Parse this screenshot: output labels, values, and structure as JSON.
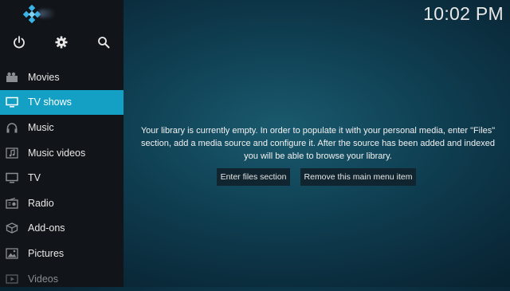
{
  "clock": "10:02 PM",
  "sidebar": {
    "logo_icon": "kodi-logo-icon",
    "top_icons": [
      "power-icon",
      "settings-gear-icon",
      "search-icon"
    ],
    "items": [
      {
        "label": "Movies",
        "icon": "movies-icon"
      },
      {
        "label": "TV shows",
        "icon": "tv-shows-icon",
        "selected": true
      },
      {
        "label": "Music",
        "icon": "headphones-icon"
      },
      {
        "label": "Music videos",
        "icon": "music-videos-icon"
      },
      {
        "label": "TV",
        "icon": "tv-icon"
      },
      {
        "label": "Radio",
        "icon": "radio-icon"
      },
      {
        "label": "Add-ons",
        "icon": "addons-box-icon"
      },
      {
        "label": "Pictures",
        "icon": "pictures-icon"
      },
      {
        "label": "Videos",
        "icon": "videos-icon"
      }
    ]
  },
  "main": {
    "empty_library_message": "Your library is currently empty. In order to populate it with your personal media, enter \"Files\" section, add a media source and configure it. After the source has been added and indexed you will be able to browse your library.",
    "buttons": {
      "enter_files": "Enter files section",
      "remove_item": "Remove this main menu item"
    }
  },
  "colors": {
    "sidebar_bg": "#111418",
    "selected_bg": "#14a0c4",
    "background_center": "#1a5a6e",
    "background_edge": "#071e2b",
    "button_bg": "#10252f"
  }
}
